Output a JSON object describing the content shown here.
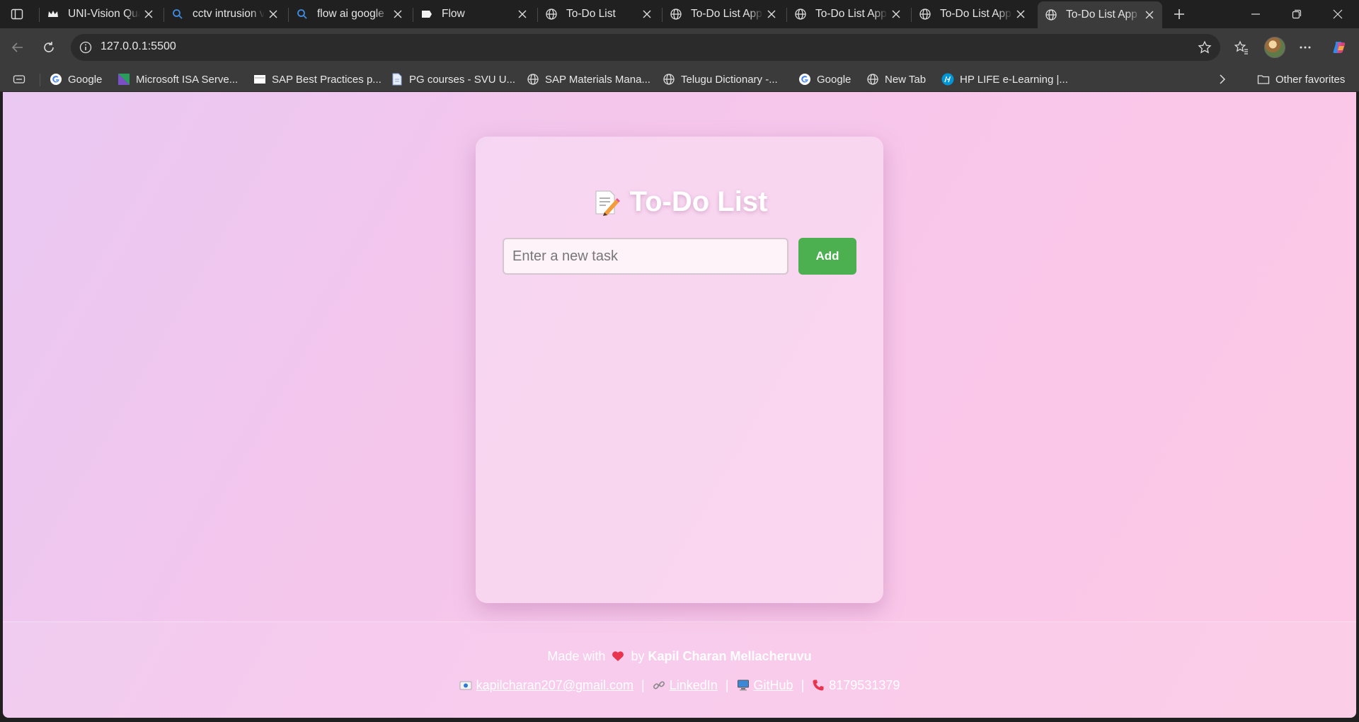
{
  "browser": {
    "tabs": [
      {
        "title": "UNI-Vision Qua"
      },
      {
        "title": "cctv intrusion v"
      },
      {
        "title": "flow ai google"
      },
      {
        "title": "Flow"
      },
      {
        "title": "To-Do List"
      },
      {
        "title": "To-Do List App"
      },
      {
        "title": "To-Do List App"
      },
      {
        "title": "To-Do List App"
      },
      {
        "title": "To-Do List App"
      }
    ],
    "address": "127.0.0.1:5500",
    "bookmarks": [
      "Google",
      "Microsoft ISA Serve...",
      "SAP Best Practices p...",
      "PG courses - SVU U...",
      "SAP Materials Mana...",
      "Telugu Dictionary -...",
      "Google",
      "New Tab",
      "HP LIFE e-Learning |..."
    ],
    "other_favorites": "Other favorites"
  },
  "app": {
    "title": "To-Do List",
    "input_placeholder": "Enter a new task",
    "input_value": "",
    "add_label": "Add",
    "tasks": []
  },
  "footer": {
    "made_with": "Made with",
    "by": "by",
    "author": "Kapil Charan Mellacheruvu",
    "email": "kapilcharan207@gmail.com",
    "linkedin": "LinkedIn",
    "github": "GitHub",
    "phone": "8179531379",
    "separator": "|"
  }
}
